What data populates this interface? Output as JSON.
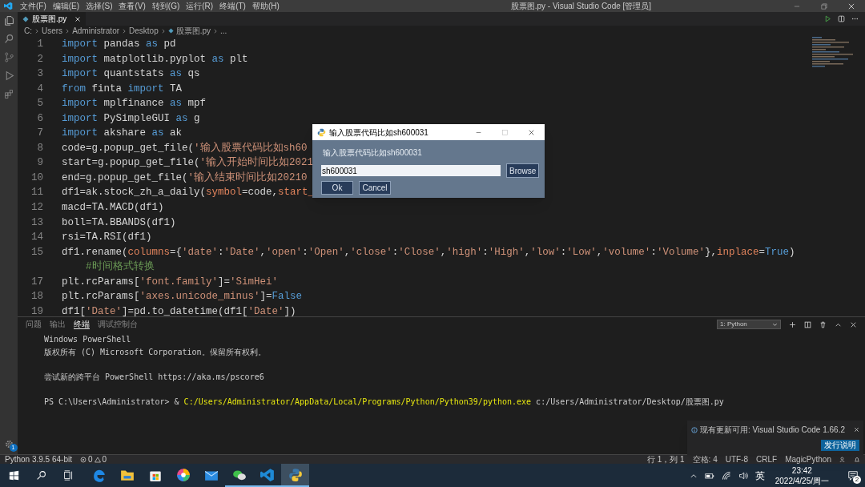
{
  "title_bar": {
    "menu": [
      "文件(F)",
      "编辑(E)",
      "选择(S)",
      "查看(V)",
      "转到(G)",
      "运行(R)",
      "终端(T)",
      "帮助(H)"
    ],
    "title": "股票图.py - Visual Studio Code [管理员]"
  },
  "editor": {
    "tabs": [
      {
        "label": "股票图.py",
        "selected": true
      }
    ],
    "breadcrumb": [
      "C:",
      "Users",
      "Administrator",
      "Desktop",
      "股票图.py",
      "..."
    ],
    "lines": [
      {
        "number": "1",
        "tokens": [
          {
            "kind": "kw",
            "text": "import"
          },
          {
            "kind": "plain",
            "text": " pandas "
          },
          {
            "kind": "kw",
            "text": "as"
          },
          {
            "kind": "plain",
            "text": " pd"
          }
        ]
      },
      {
        "number": "2",
        "tokens": [
          {
            "kind": "kw",
            "text": "import"
          },
          {
            "kind": "plain",
            "text": " matplotlib.pyplot "
          },
          {
            "kind": "kw",
            "text": "as"
          },
          {
            "kind": "plain",
            "text": " plt"
          }
        ]
      },
      {
        "number": "3",
        "tokens": [
          {
            "kind": "kw",
            "text": "import"
          },
          {
            "kind": "plain",
            "text": " quantstats "
          },
          {
            "kind": "kw",
            "text": "as"
          },
          {
            "kind": "plain",
            "text": " qs"
          }
        ]
      },
      {
        "number": "4",
        "tokens": [
          {
            "kind": "kw",
            "text": "from"
          },
          {
            "kind": "plain",
            "text": " finta "
          },
          {
            "kind": "kw",
            "text": "import"
          },
          {
            "kind": "plain",
            "text": " TA"
          }
        ]
      },
      {
        "number": "5",
        "tokens": [
          {
            "kind": "kw",
            "text": "import"
          },
          {
            "kind": "plain",
            "text": " mplfinance "
          },
          {
            "kind": "kw",
            "text": "as"
          },
          {
            "kind": "plain",
            "text": " mpf"
          }
        ]
      },
      {
        "number": "6",
        "tokens": [
          {
            "kind": "kw",
            "text": "import"
          },
          {
            "kind": "plain",
            "text": " PySimpleGUI "
          },
          {
            "kind": "kw",
            "text": "as"
          },
          {
            "kind": "plain",
            "text": " g"
          }
        ]
      },
      {
        "number": "7",
        "tokens": [
          {
            "kind": "kw",
            "text": "import"
          },
          {
            "kind": "plain",
            "text": " akshare "
          },
          {
            "kind": "kw",
            "text": "as"
          },
          {
            "kind": "plain",
            "text": " ak"
          }
        ]
      },
      {
        "number": "8",
        "tokens": [
          {
            "kind": "plain",
            "text": "code=g.popup_get_file("
          },
          {
            "kind": "str",
            "text": "'输入股票代码比如sh60"
          }
        ]
      },
      {
        "number": "9",
        "tokens": [
          {
            "kind": "plain",
            "text": "start=g.popup_get_file("
          },
          {
            "kind": "str",
            "text": "'输入开始时间比如2021"
          }
        ]
      },
      {
        "number": "10",
        "tokens": [
          {
            "kind": "plain",
            "text": "end=g.popup_get_file("
          },
          {
            "kind": "str",
            "text": "'输入结束时间比如20210"
          }
        ]
      },
      {
        "number": "11",
        "tokens": [
          {
            "kind": "plain",
            "text": "df1=ak.stock_zh_a_daily("
          },
          {
            "kind": "param",
            "text": "symbol"
          },
          {
            "kind": "plain",
            "text": "=code,"
          },
          {
            "kind": "param",
            "text": "start_"
          }
        ]
      },
      {
        "number": "12",
        "tokens": [
          {
            "kind": "plain",
            "text": "macd=TA.MACD(df1)"
          }
        ]
      },
      {
        "number": "13",
        "tokens": [
          {
            "kind": "plain",
            "text": "boll=TA.BBANDS(df1)"
          }
        ]
      },
      {
        "number": "14",
        "tokens": [
          {
            "kind": "plain",
            "text": "rsi=TA.RSI(df1)"
          }
        ]
      },
      {
        "number": "15",
        "tokens": [
          {
            "kind": "plain",
            "text": "df1.rename("
          },
          {
            "kind": "param",
            "text": "columns"
          },
          {
            "kind": "plain",
            "text": "={"
          },
          {
            "kind": "str",
            "text": "'date'"
          },
          {
            "kind": "plain",
            "text": ":"
          },
          {
            "kind": "str",
            "text": "'Date'"
          },
          {
            "kind": "plain",
            "text": ","
          },
          {
            "kind": "str",
            "text": "'open'"
          },
          {
            "kind": "plain",
            "text": ":"
          },
          {
            "kind": "str",
            "text": "'Open'"
          },
          {
            "kind": "plain",
            "text": ","
          },
          {
            "kind": "str",
            "text": "'close'"
          },
          {
            "kind": "plain",
            "text": ":"
          },
          {
            "kind": "str",
            "text": "'Close'"
          },
          {
            "kind": "plain",
            "text": ","
          },
          {
            "kind": "str",
            "text": "'high'"
          },
          {
            "kind": "plain",
            "text": ":"
          },
          {
            "kind": "str",
            "text": "'High'"
          },
          {
            "kind": "plain",
            "text": ","
          },
          {
            "kind": "str",
            "text": "'low'"
          },
          {
            "kind": "plain",
            "text": ":"
          },
          {
            "kind": "str",
            "text": "'Low'"
          },
          {
            "kind": "plain",
            "text": ","
          },
          {
            "kind": "str",
            "text": "'volume'"
          },
          {
            "kind": "plain",
            "text": ":"
          },
          {
            "kind": "str",
            "text": "'Volume'"
          },
          {
            "kind": "plain",
            "text": "},"
          },
          {
            "kind": "param",
            "text": "inplace"
          },
          {
            "kind": "plain",
            "text": "="
          },
          {
            "kind": "const",
            "text": "True"
          },
          {
            "kind": "plain",
            "text": ")"
          }
        ]
      },
      {
        "tokens": [
          {
            "kind": "comment",
            "text": "    #时间格式转换"
          }
        ]
      },
      {
        "number": "17",
        "tokens": [
          {
            "kind": "plain",
            "text": "plt.rcParams["
          },
          {
            "kind": "str",
            "text": "'font.family'"
          },
          {
            "kind": "plain",
            "text": "]="
          },
          {
            "kind": "str",
            "text": "'SimHei'"
          }
        ]
      },
      {
        "number": "18",
        "tokens": [
          {
            "kind": "plain",
            "text": "plt.rcParams["
          },
          {
            "kind": "str",
            "text": "'axes.unicode_minus'"
          },
          {
            "kind": "plain",
            "text": "]="
          },
          {
            "kind": "const",
            "text": "False"
          }
        ]
      },
      {
        "number": "19",
        "tokens": [
          {
            "kind": "plain",
            "text": "df1["
          },
          {
            "kind": "str",
            "text": "'Date'"
          },
          {
            "kind": "plain",
            "text": "]=pd.to_datetime(df1["
          },
          {
            "kind": "str",
            "text": "'Date'"
          },
          {
            "kind": "plain",
            "text": "])"
          }
        ]
      }
    ]
  },
  "dialog": {
    "title": "输入股票代码比如sh600031",
    "label": "输入股票代码比如sh600031",
    "value": "sh600031",
    "browse": "Browse",
    "ok": "Ok",
    "cancel": "Cancel"
  },
  "panel": {
    "tabs": [
      {
        "label": "问题",
        "selected": false
      },
      {
        "label": "输出",
        "selected": false
      },
      {
        "label": "终端",
        "selected": true
      },
      {
        "label": "调试控制台",
        "selected": false
      }
    ],
    "terminal_select": "1: Python",
    "blocks": [
      [
        [
          {
            "kind": "plain",
            "text": "Windows PowerShell"
          }
        ],
        [
          {
            "kind": "plain",
            "text": "版权所有 (C) Microsoft Corporation。保留所有权利。"
          }
        ]
      ],
      [
        [
          {
            "kind": "plain",
            "text": "尝试新的跨平台 PowerShell https://aka.ms/pscore6"
          }
        ]
      ],
      [
        [
          {
            "kind": "plain",
            "text": "PS C:\\Users\\Administrator> & "
          },
          {
            "kind": "path",
            "text": "C:/Users/Administrator/AppData/Local/Programs/Python/Python39/python.exe"
          },
          {
            "kind": "plain",
            "text": " c:/Users/Administrator/Desktop/股票图.py"
          }
        ]
      ]
    ]
  },
  "notification": {
    "message": "现有更新可用: Visual Studio Code 1.66.2",
    "buttons": [
      "发行说明"
    ]
  },
  "activity_badge": "1",
  "status_bar": {
    "interpreter": "Python 3.9.5 64-bit",
    "errors": "0",
    "warnings": "0",
    "right": [
      "行 1，列 1",
      "空格: 4",
      "UTF-8",
      "CRLF",
      "MagicPython"
    ]
  },
  "taskbar": {
    "apps": [
      {
        "kind": "edge",
        "running": false
      },
      {
        "kind": "explorer",
        "running": false
      },
      {
        "kind": "store",
        "running": false
      },
      {
        "kind": "photos",
        "running": false
      },
      {
        "kind": "mail",
        "running": false
      },
      {
        "kind": "wechat",
        "running": true
      },
      {
        "kind": "vscode",
        "running": true
      },
      {
        "kind": "python",
        "running": true,
        "selected": true
      }
    ],
    "ime": "英",
    "time": "23:42",
    "date": "2022/4/25/周一",
    "notifications": "2"
  }
}
